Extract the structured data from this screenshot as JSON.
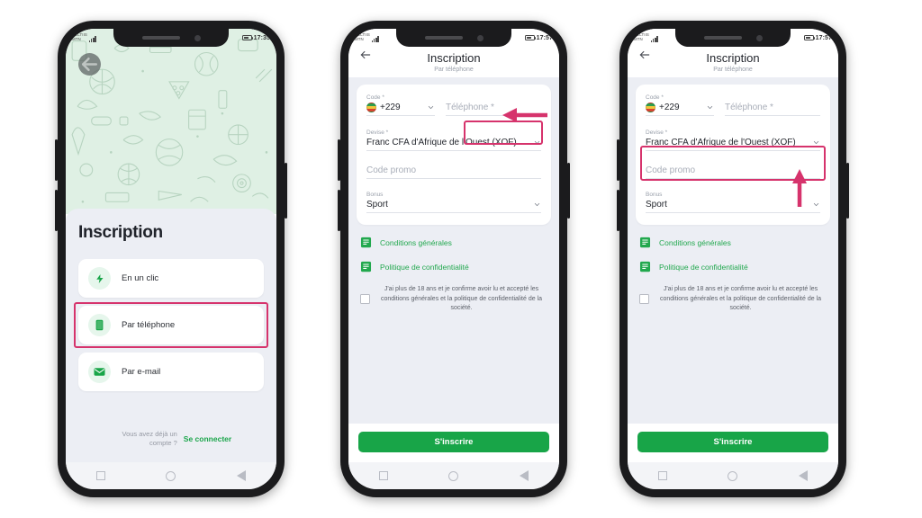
{
  "accent": {
    "green": "#18a548",
    "green_light": "#22a84e",
    "highlight_pink": "#d6336c",
    "sheet_bg": "#eceef4",
    "hero_bg": "#dff0e4"
  },
  "phone1": {
    "status": {
      "carrier_line1": "CELTIIS",
      "carrier_line2": "MTN",
      "network": "4G",
      "time": "17:35"
    },
    "back_icon": "back-arrow-icon",
    "title": "Inscription",
    "options": [
      {
        "icon": "lightning-bolt-icon",
        "label": "En un clic",
        "highlighted": false
      },
      {
        "icon": "phone-icon",
        "label": "Par téléphone",
        "highlighted": true
      },
      {
        "icon": "envelope-icon",
        "label": "Par e-mail",
        "highlighted": false
      }
    ],
    "footer": {
      "question": "Vous avez déjà un compte ?",
      "link": "Se connecter"
    },
    "navbar": {
      "recent": "square-icon",
      "home": "circle-icon",
      "back": "triangle-back-icon"
    }
  },
  "phone2": {
    "status": {
      "carrier_line1": "CELTIIS",
      "carrier_line2": "MTN",
      "network": "4G",
      "time": "17:57"
    },
    "appbar": {
      "back_icon": "back-arrow-icon",
      "title": "Inscription",
      "subtitle": "Par téléphone"
    },
    "form": {
      "code": {
        "label": "Code *",
        "value": "+229",
        "flag": "benin-flag-icon",
        "chevron": "chevron-down-icon"
      },
      "phone": {
        "placeholder": "Téléphone *",
        "value": "",
        "highlighted": true
      },
      "currency": {
        "label": "Devise *",
        "value": "Franc CFA d'Afrique de l'Ouest (XOF)",
        "chevron": "chevron-down-icon",
        "highlighted": false
      },
      "promo": {
        "placeholder": "Code promo",
        "value": ""
      },
      "bonus": {
        "label": "Bonus",
        "value": "Sport",
        "chevron": "chevron-down-icon"
      }
    },
    "links": [
      {
        "icon": "document-icon",
        "label": "Conditions générales"
      },
      {
        "icon": "document-icon",
        "label": "Politique de confidentialité"
      }
    ],
    "agreement": {
      "checkbox": "age-terms-checkbox",
      "checked": false,
      "text": "J'ai plus de 18 ans et je confirme avoir lu et accepté les conditions générales et la politique de confidentialité de la société."
    },
    "submit_label": "S'inscrire",
    "annotation": {
      "type": "arrow-left",
      "target": "phone-input"
    }
  },
  "phone3": {
    "status": {
      "carrier_line1": "CELTIIS",
      "carrier_line2": "MTN",
      "network": "4G",
      "time": "17:57"
    },
    "appbar": {
      "back_icon": "back-arrow-icon",
      "title": "Inscription",
      "subtitle": "Par téléphone"
    },
    "form": {
      "code": {
        "label": "Code *",
        "value": "+229",
        "flag": "benin-flag-icon",
        "chevron": "chevron-down-icon"
      },
      "phone": {
        "placeholder": "Téléphone *",
        "value": "",
        "highlighted": false
      },
      "currency": {
        "label": "Devise *",
        "value": "Franc CFA d'Afrique de l'Ouest (XOF)",
        "chevron": "chevron-down-icon",
        "highlighted": true
      },
      "promo": {
        "placeholder": "Code promo",
        "value": ""
      },
      "bonus": {
        "label": "Bonus",
        "value": "Sport",
        "chevron": "chevron-down-icon"
      }
    },
    "links": [
      {
        "icon": "document-icon",
        "label": "Conditions générales"
      },
      {
        "icon": "document-icon",
        "label": "Politique de confidentialité"
      }
    ],
    "agreement": {
      "checkbox": "age-terms-checkbox",
      "checked": false,
      "text": "J'ai plus de 18 ans et je confirme avoir lu et accepté les conditions générales et la politique de confidentialité de la société."
    },
    "submit_label": "S'inscrire",
    "annotation": {
      "type": "arrow-up",
      "target": "currency-select"
    }
  }
}
